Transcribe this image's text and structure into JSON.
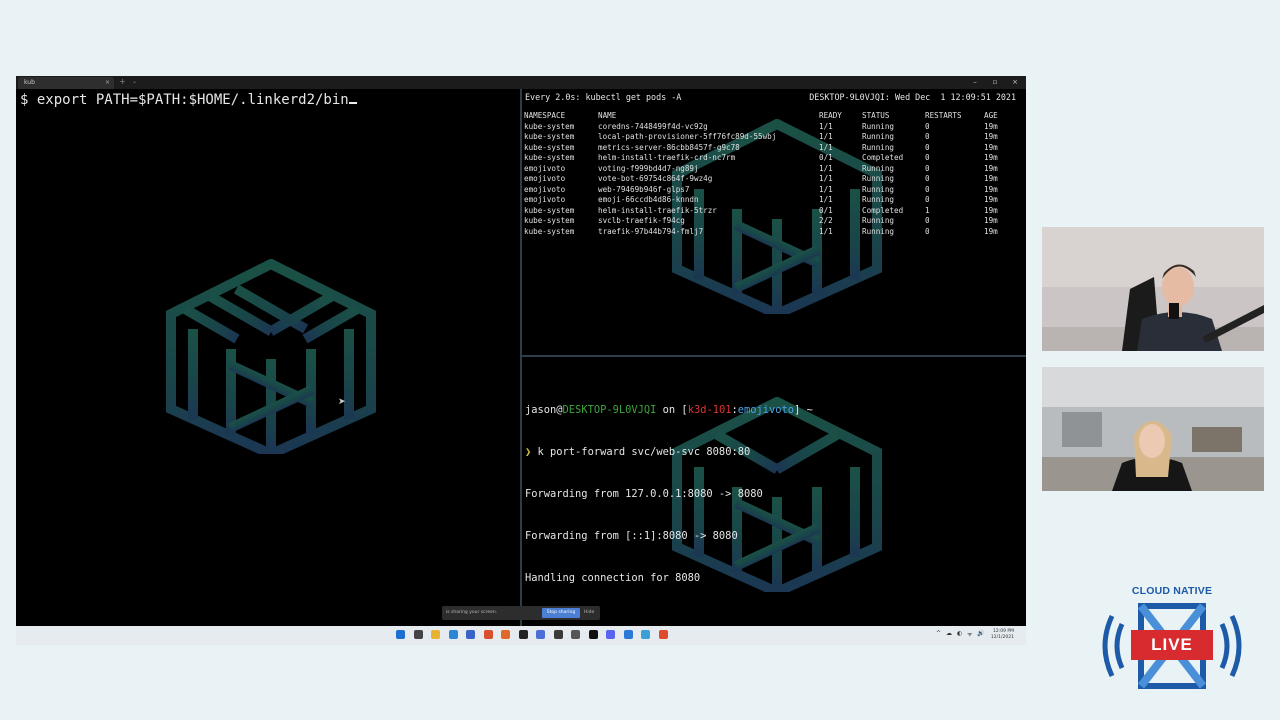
{
  "window": {
    "tab_title": "kub",
    "tab_close": "×",
    "new_tab": "+",
    "tab_dropdown": "⌄",
    "controls": [
      "–",
      "▫",
      "×"
    ]
  },
  "left_pane": {
    "prompt": "$ export PATH=$PATH:$HOME/.linkerd2/bin"
  },
  "top_right_pane": {
    "watch_header": "Every 2.0s: kubectl get pods -A",
    "watch_host": "DESKTOP-9L0VJQI: Wed Dec  1 12:09:51 2021",
    "columns": [
      "NAMESPACE",
      "NAME",
      "READY",
      "STATUS",
      "RESTARTS",
      "AGE"
    ],
    "rows": [
      [
        "kube-system",
        "coredns-7448499f4d-vc92g",
        "1/1",
        "Running",
        "0",
        "19m"
      ],
      [
        "kube-system",
        "local-path-provisioner-5ff76fc89d-55wbj",
        "1/1",
        "Running",
        "0",
        "19m"
      ],
      [
        "kube-system",
        "metrics-server-86cbb8457f-g9c78",
        "1/1",
        "Running",
        "0",
        "19m"
      ],
      [
        "kube-system",
        "helm-install-traefik-crd-nc7rm",
        "0/1",
        "Completed",
        "0",
        "19m"
      ],
      [
        "emojivoto",
        "voting-f999bd4d7-ng89j",
        "1/1",
        "Running",
        "0",
        "19m"
      ],
      [
        "emojivoto",
        "vote-bot-69754c864f-9wz4g",
        "1/1",
        "Running",
        "0",
        "19m"
      ],
      [
        "emojivoto",
        "web-79469b946f-glps7",
        "1/1",
        "Running",
        "0",
        "19m"
      ],
      [
        "emojivoto",
        "emoji-66ccdb4d86-knndn",
        "1/1",
        "Running",
        "0",
        "19m"
      ],
      [
        "kube-system",
        "helm-install-traefik-5trzr",
        "0/1",
        "Completed",
        "1",
        "19m"
      ],
      [
        "kube-system",
        "svclb-traefik-f94cg",
        "2/2",
        "Running",
        "0",
        "19m"
      ],
      [
        "kube-system",
        "traefik-97b44b794-fmlj7",
        "1/1",
        "Running",
        "0",
        "19m"
      ]
    ]
  },
  "bottom_right_pane": {
    "user": "jason",
    "at": "@",
    "host": "DESKTOP-9L0VJQI",
    "on": " on ",
    "bracket_open": "[",
    "context": "k3d-101",
    "colon": ":",
    "namespace": "emojivoto",
    "bracket_close": "]",
    "tilde": " ~",
    "arrow": "❯",
    "command": " k port-forward svc/web-svc 8080:80",
    "output": [
      "Forwarding from 127.0.0.1:8080 -> 8080",
      "Forwarding from [::1]:8080 -> 8080",
      "Handling connection for 8080"
    ]
  },
  "notification": {
    "text": "is sharing your screen.",
    "stop_label": "Stop sharing",
    "hide_label": "Hide"
  },
  "taskbar": {
    "icon_colors": [
      "#1f6fd1",
      "#444444",
      "#e8b233",
      "#2c86d8",
      "#3a63c9",
      "#d9502f",
      "#e0692a",
      "#222222",
      "#4a6fd6",
      "#3a3a3a",
      "#555555",
      "#111111",
      "#5865f2",
      "#2a7ad6",
      "#39a0d8",
      "#e04b2c"
    ],
    "tray_symbols": [
      "^",
      "☁",
      "◐",
      "ᯤ",
      "🔊",
      "⌨"
    ],
    "clock_time": "12:09 PM",
    "clock_date": "12/1/2021"
  },
  "brand": {
    "title": "CLOUD NATIVE",
    "live": "LIVE",
    "colors": {
      "blue": "#1d5aa8",
      "red": "#d72b2f",
      "light_blue": "#4a90d9"
    }
  },
  "colors": {
    "logo_green": "#1d5a4e",
    "logo_blue": "#1f3d5c",
    "terminal_bg": "#000000",
    "screen_bg": "#e9f3f5"
  }
}
